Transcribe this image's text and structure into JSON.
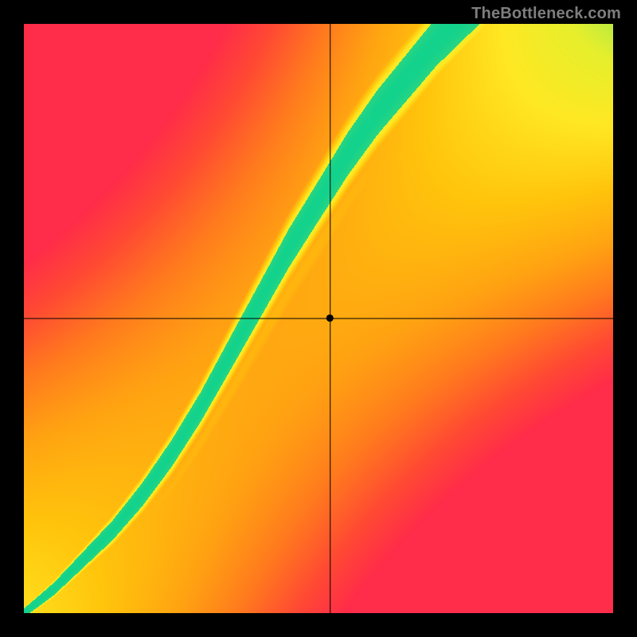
{
  "watermark": "TheBottleneck.com",
  "chart_data": {
    "type": "heatmap",
    "title": "",
    "xlabel": "",
    "ylabel": "",
    "xlim": [
      0,
      1
    ],
    "ylim": [
      0,
      1
    ],
    "crosshair": {
      "x": 0.52,
      "y": 0.5
    },
    "marker": {
      "x": 0.52,
      "y": 0.5
    },
    "colorscale": [
      {
        "t": 0.0,
        "hex": "#ff2c4a"
      },
      {
        "t": 0.12,
        "hex": "#ff4a33"
      },
      {
        "t": 0.25,
        "hex": "#ff7a1e"
      },
      {
        "t": 0.38,
        "hex": "#ffa312"
      },
      {
        "t": 0.52,
        "hex": "#ffc50c"
      },
      {
        "t": 0.66,
        "hex": "#ffe823"
      },
      {
        "t": 0.78,
        "hex": "#e7ef2c"
      },
      {
        "t": 0.88,
        "hex": "#9fe94e"
      },
      {
        "t": 1.0,
        "hex": "#12d28d"
      }
    ],
    "ridge": {
      "x": [
        0.0,
        0.05,
        0.1,
        0.15,
        0.2,
        0.25,
        0.3,
        0.35,
        0.4,
        0.45,
        0.5,
        0.55,
        0.6,
        0.65,
        0.7,
        0.75,
        0.8,
        0.85,
        0.9,
        0.95,
        1.0
      ],
      "y": [
        0.0,
        0.04,
        0.09,
        0.14,
        0.2,
        0.27,
        0.35,
        0.44,
        0.53,
        0.62,
        0.7,
        0.78,
        0.85,
        0.91,
        0.97,
        1.02,
        1.07,
        1.12,
        1.16,
        1.2,
        1.24
      ],
      "half_width": [
        0.01,
        0.014,
        0.018,
        0.022,
        0.026,
        0.03,
        0.033,
        0.037,
        0.04,
        0.043,
        0.045,
        0.048,
        0.05,
        0.052,
        0.054,
        0.056,
        0.058,
        0.06,
        0.062,
        0.064,
        0.066
      ]
    },
    "secondary_ridge": {
      "offset": 0.12,
      "intensity": 0.48
    },
    "corner_bias": {
      "top_left_red": 0.85,
      "bottom_right_red": 0.95,
      "top_right_yellow": 0.6,
      "bottom_left_origin": 1.0
    }
  }
}
